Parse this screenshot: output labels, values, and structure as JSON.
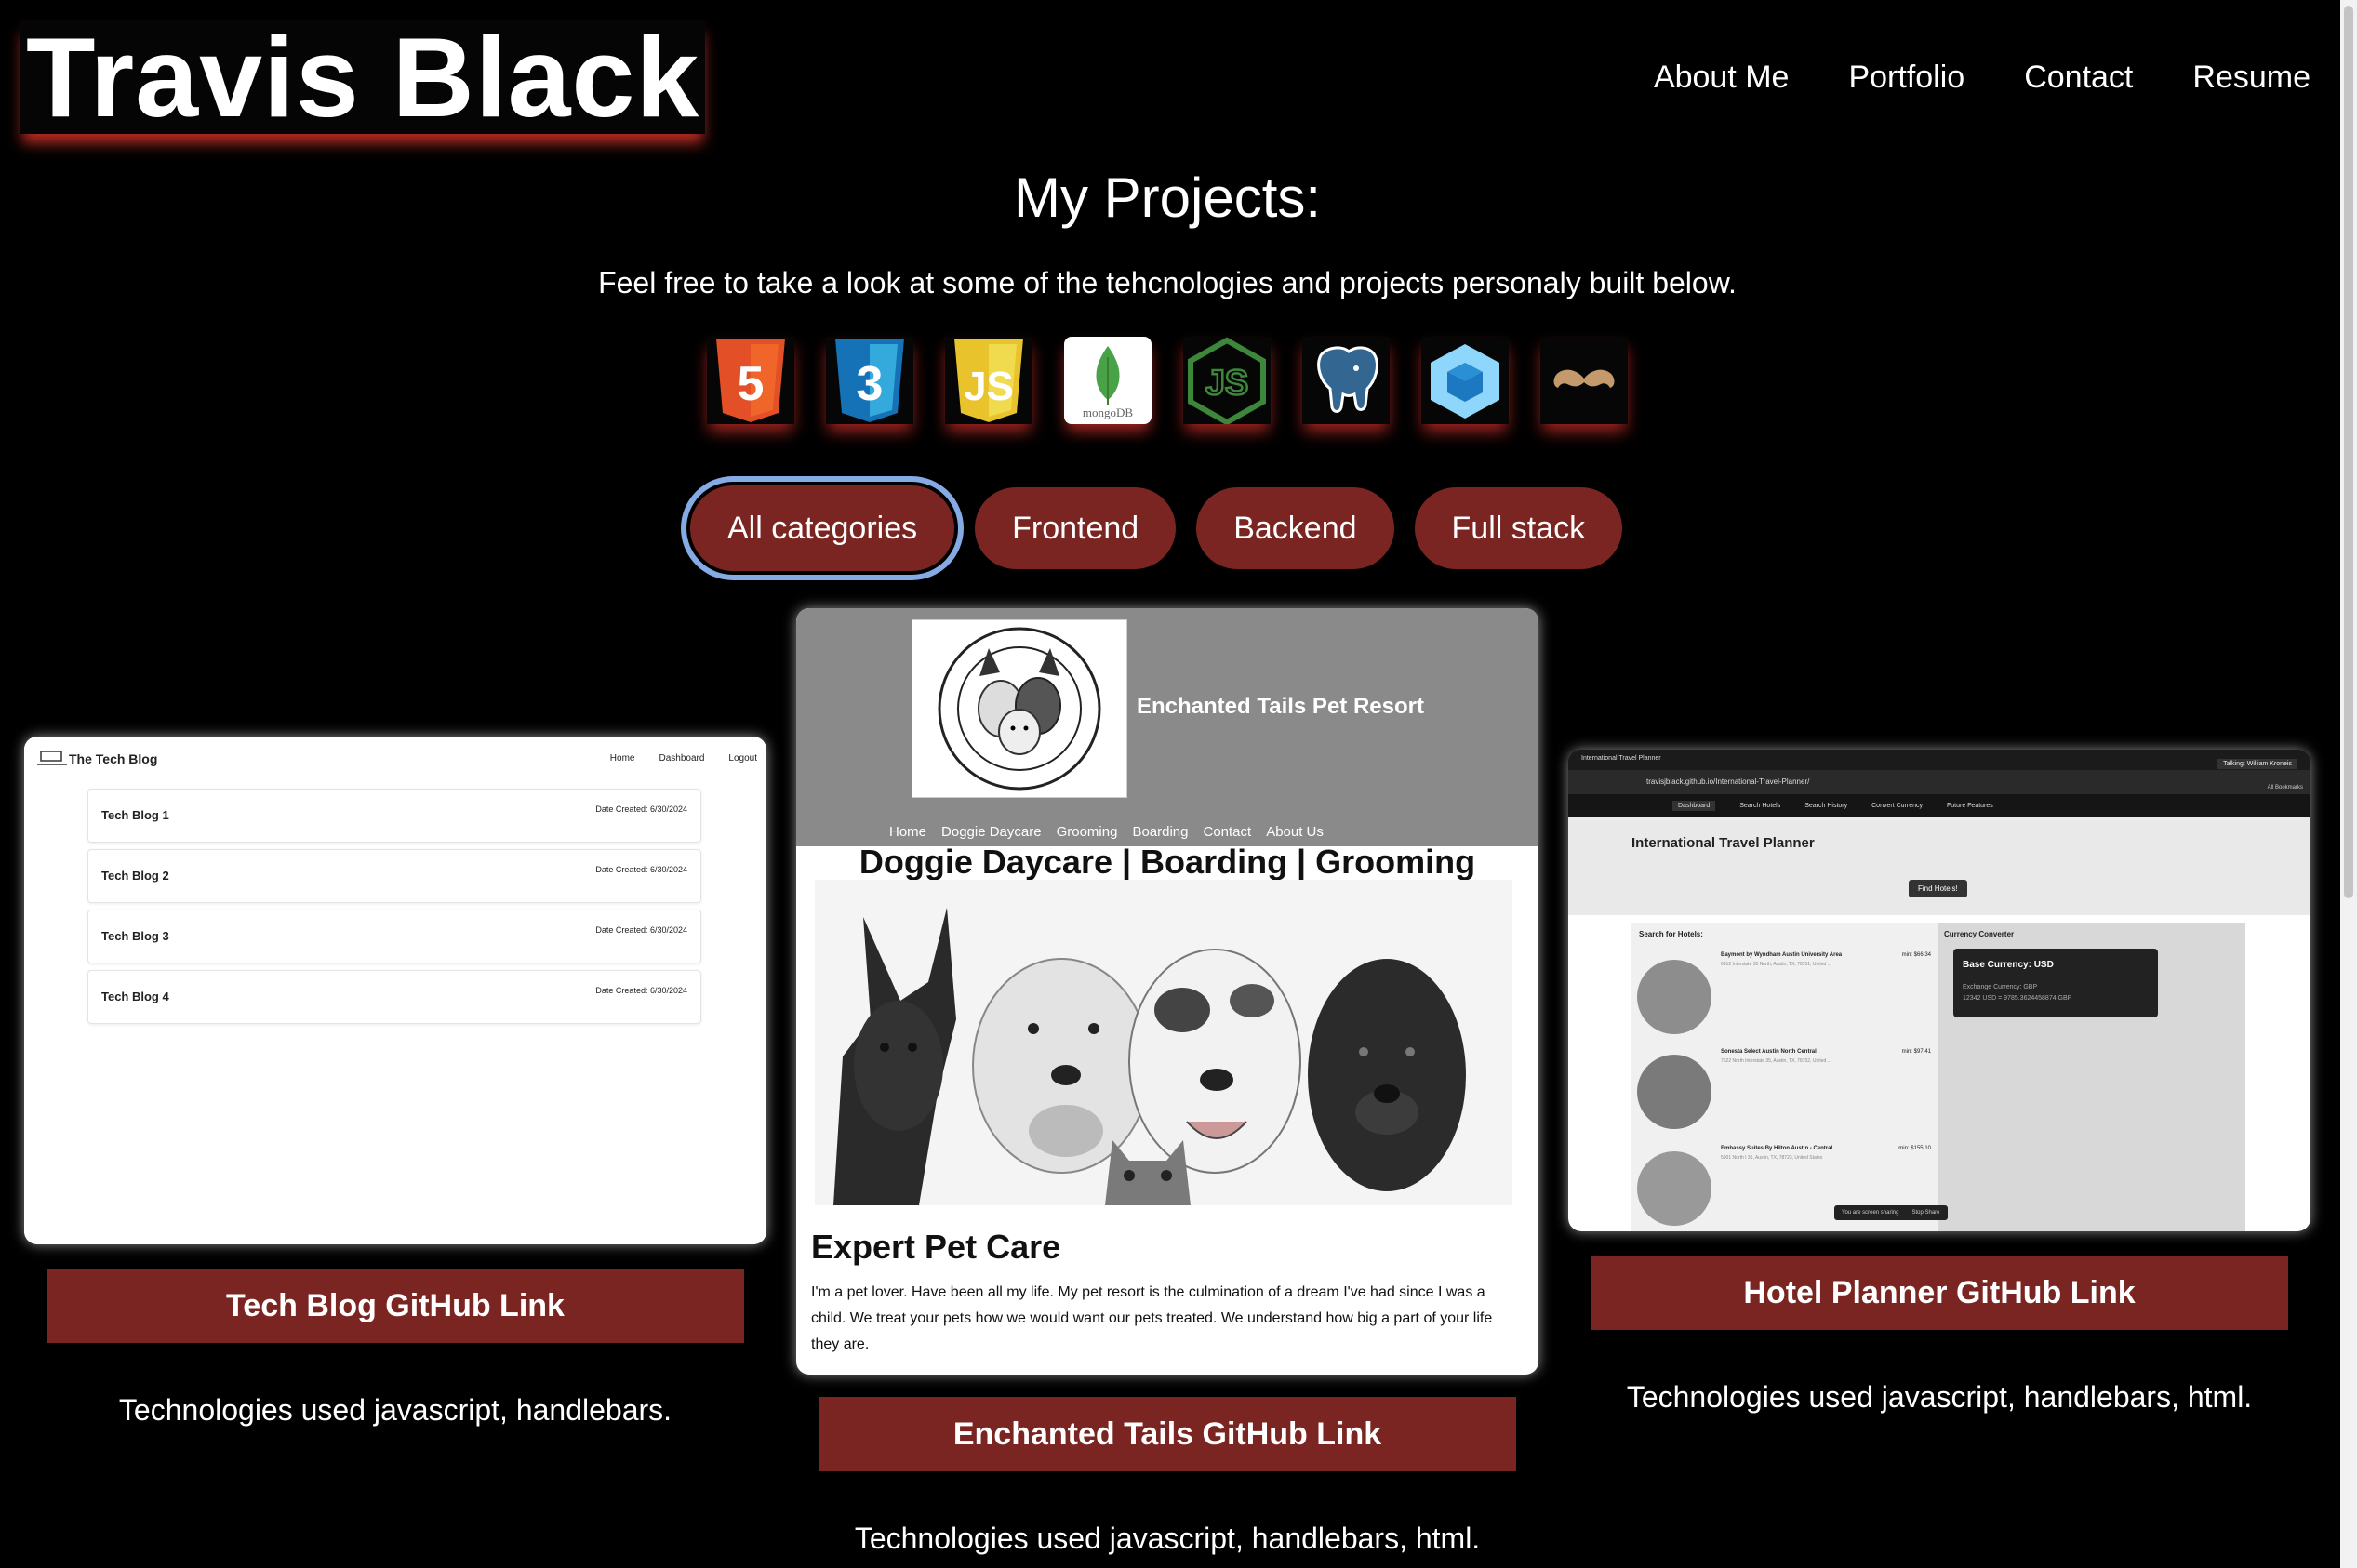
{
  "header": {
    "brand": "Travis Black"
  },
  "nav": [
    "About Me",
    "Portfolio",
    "Contact",
    "Resume"
  ],
  "projects": {
    "title": "My Projects:",
    "subtitle": "Feel free to take a look at some of the tehcnologies and projects personaly built below."
  },
  "techs": [
    {
      "icon": "html5-icon",
      "color": "#e34f26",
      "text": "5"
    },
    {
      "icon": "css3-icon",
      "color": "#1572b6",
      "text": "3"
    },
    {
      "icon": "javascript-icon",
      "color": "#f0db4f",
      "text": "JS"
    },
    {
      "icon": "mongodb-icon",
      "color": "#47a248",
      "text": "mongoDB"
    },
    {
      "icon": "nodejs-icon",
      "color": "#3c873a",
      "text": "JS"
    },
    {
      "icon": "postgresql-icon",
      "color": "#336791"
    },
    {
      "icon": "webpack-icon",
      "color": "#8ed6fb"
    },
    {
      "icon": "handlebars-icon",
      "color": "#c49a6c"
    }
  ],
  "filters": [
    "All categories",
    "Frontend",
    "Backend",
    "Full stack"
  ],
  "cards": {
    "techblog": {
      "app_title": "The Tech Blog",
      "nav": [
        "Home",
        "Dashboard",
        "Logout"
      ],
      "posts": [
        {
          "title": "Tech Blog 1",
          "date": "Date Created: 6/30/2024"
        },
        {
          "title": "Tech Blog 2",
          "date": "Date Created: 6/30/2024"
        },
        {
          "title": "Tech Blog 3",
          "date": "Date Created: 6/30/2024"
        },
        {
          "title": "Tech Blog 4",
          "date": "Date Created: 6/30/2024"
        }
      ],
      "link": "Tech Blog GitHub Link",
      "tech": "Technologies used javascript, handlebars."
    },
    "enchanted": {
      "brand": "Enchanted Tails Pet Resort",
      "logo_text": "ENCHANTED TAILS PET RESORT AND SERVICES",
      "nav": [
        "Home",
        "Doggie Daycare",
        "Grooming",
        "Boarding",
        "Contact",
        "About Us"
      ],
      "hero": "Doggie Daycare | Boarding | Grooming",
      "heading": "Expert Pet Care",
      "body": "I'm a pet lover. Have been all my life. My pet resort is the culmination of a dream I've had since I was a child. We treat your pets how we would want our pets treated. We understand how big a part of your life they are.",
      "link": "Enchanted Tails GitHub Link",
      "tech": "Technologies used javascript, handlebars, html."
    },
    "hotel": {
      "tab": "International Travel Planner",
      "url": "travisjblack.github.io/International-Travel-Planner/",
      "talking": "Talking: William Kroneis",
      "bookmarks": "All Bookmarks",
      "nav": [
        "Dashboard",
        "Search Hotels",
        "Search History",
        "Convert Currency",
        "Future Features"
      ],
      "title": "International Travel Planner",
      "find_btn": "Find Hotels!",
      "search_label": "Search for Hotels:",
      "hotels": [
        {
          "name": "Baymont by Wyndham Austin University Area",
          "price": "min: $66.34",
          "addr": "6912 Interstate 35 North, Austin, TX, 78751, United ..."
        },
        {
          "name": "Sonesta Select Austin North Central",
          "price": "min: $97.41",
          "addr": "7522 North Interstate 35, Austin, TX, 78752, United ..."
        },
        {
          "name": "Embassy Suites By Hilton Austin - Central",
          "price": "min: $155.10",
          "addr": "5901 North I 35, Austin, TX, 78723, United States"
        }
      ],
      "currency_label": "Currency Converter",
      "base_currency": "Base Currency: USD",
      "exchange": "Exchange Currency: GBP",
      "result": "12342 USD = 9785.3624458874 GBP",
      "sharing": "You are screen sharing",
      "stop": "Stop Share",
      "link": "Hotel Planner GitHub Link",
      "tech": "Technologies used javascript, handlebars, html."
    }
  }
}
